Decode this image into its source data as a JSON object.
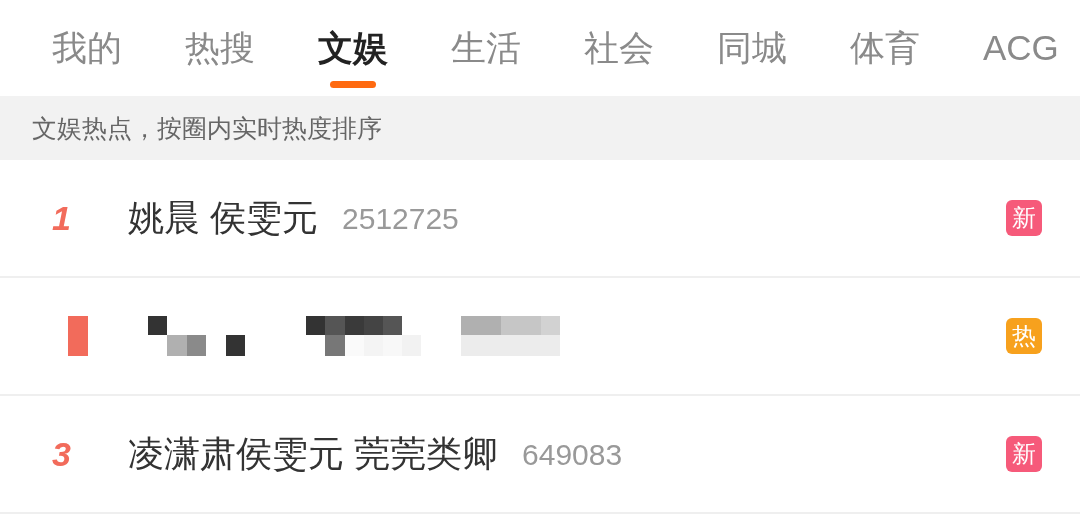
{
  "tabs": [
    {
      "label": "我的",
      "selected": false
    },
    {
      "label": "热搜",
      "selected": false
    },
    {
      "label": "文娱",
      "selected": true
    },
    {
      "label": "生活",
      "selected": false
    },
    {
      "label": "社会",
      "selected": false
    },
    {
      "label": "同城",
      "selected": false
    },
    {
      "label": "体育",
      "selected": false
    },
    {
      "label": "ACG",
      "selected": false
    }
  ],
  "subheader": "文娱热点，按圈内实时热度排序",
  "rows": [
    {
      "kind": "text",
      "rank": "1",
      "title": "姚晨 侯雯元",
      "count": "2512725",
      "badge": {
        "label": "新",
        "color": "#f65a7a"
      }
    },
    {
      "kind": "pixelated",
      "badge": {
        "label": "热",
        "color": "#f7a11d"
      }
    },
    {
      "kind": "text",
      "rank": "3",
      "title": "凌潇肃侯雯元 莞莞类卿",
      "count": "649083",
      "badge": {
        "label": "新",
        "color": "#f65a7a"
      }
    }
  ]
}
